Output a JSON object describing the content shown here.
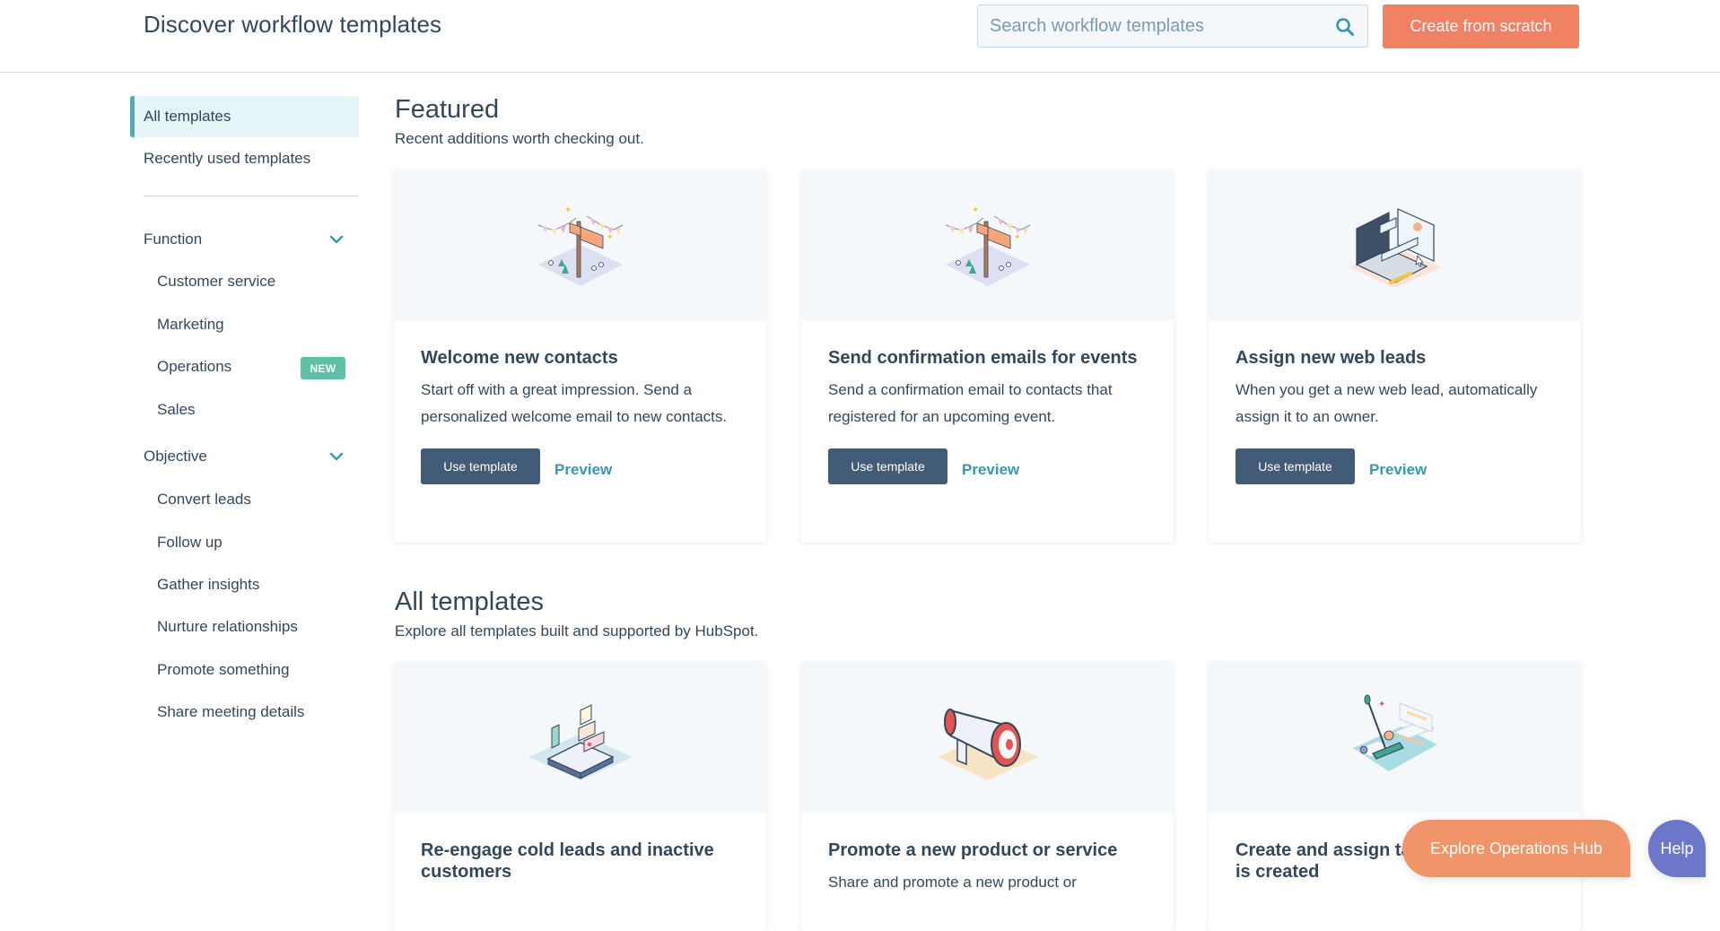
{
  "header": {
    "title": "Discover workflow templates",
    "search_placeholder": "Search workflow templates",
    "search_value": "",
    "create_button": "Create from scratch"
  },
  "sidebar": {
    "top_items": [
      {
        "label": "All templates",
        "active": true
      },
      {
        "label": "Recently used templates",
        "active": false
      }
    ],
    "groups": [
      {
        "label": "Function",
        "expanded": true,
        "items": [
          {
            "label": "Customer service"
          },
          {
            "label": "Marketing"
          },
          {
            "label": "Operations",
            "badge": "NEW"
          },
          {
            "label": "Sales"
          }
        ]
      },
      {
        "label": "Objective",
        "expanded": true,
        "items": [
          {
            "label": "Convert leads"
          },
          {
            "label": "Follow up"
          },
          {
            "label": "Gather insights"
          },
          {
            "label": "Nurture relationships"
          },
          {
            "label": "Promote something"
          },
          {
            "label": "Share meeting details"
          }
        ]
      }
    ]
  },
  "featured": {
    "title": "Featured",
    "subtitle": "Recent additions worth checking out.",
    "cards": [
      {
        "illustration": "welcome-flag-illustration",
        "title": "Welcome new contacts",
        "description": "Start off with a great impression. Send a personalized welcome email to new contacts.",
        "use_label": "Use template",
        "preview_label": "Preview"
      },
      {
        "illustration": "welcome-flag-illustration",
        "title": "Send confirmation emails for events",
        "description": "Send a confirmation email to contacts that registered for an upcoming event.",
        "use_label": "Use template",
        "preview_label": "Preview"
      },
      {
        "illustration": "laptop-illustration",
        "title": "Assign new web leads",
        "description": "When you get a new web lead, automatically assign it to an owner.",
        "use_label": "Use template",
        "preview_label": "Preview"
      }
    ]
  },
  "all_templates": {
    "title": "All templates",
    "subtitle": "Explore all templates built and supported by HubSpot.",
    "cards": [
      {
        "illustration": "open-book-illustration",
        "title": "Re-engage cold leads and inactive customers",
        "description": ""
      },
      {
        "illustration": "megaphone-illustration",
        "title": "Promote a new product or service",
        "description": "Share and promote a new product or"
      },
      {
        "illustration": "mop-cleanup-illustration",
        "title": "Create and assign tasks when a deal is created",
        "description": ""
      }
    ]
  },
  "floating": {
    "explore_button": "Explore Operations Hub",
    "help_button": "Help"
  },
  "colors": {
    "primary_text": "#33475b",
    "accent_orange": "#f08164",
    "teal_link": "#3797b0",
    "button_dark": "#425b76",
    "badge_green": "#5ec0a5",
    "help_purple": "#6c77c9",
    "explore_orange": "#f0956a",
    "active_bg": "#e5f5f8"
  }
}
